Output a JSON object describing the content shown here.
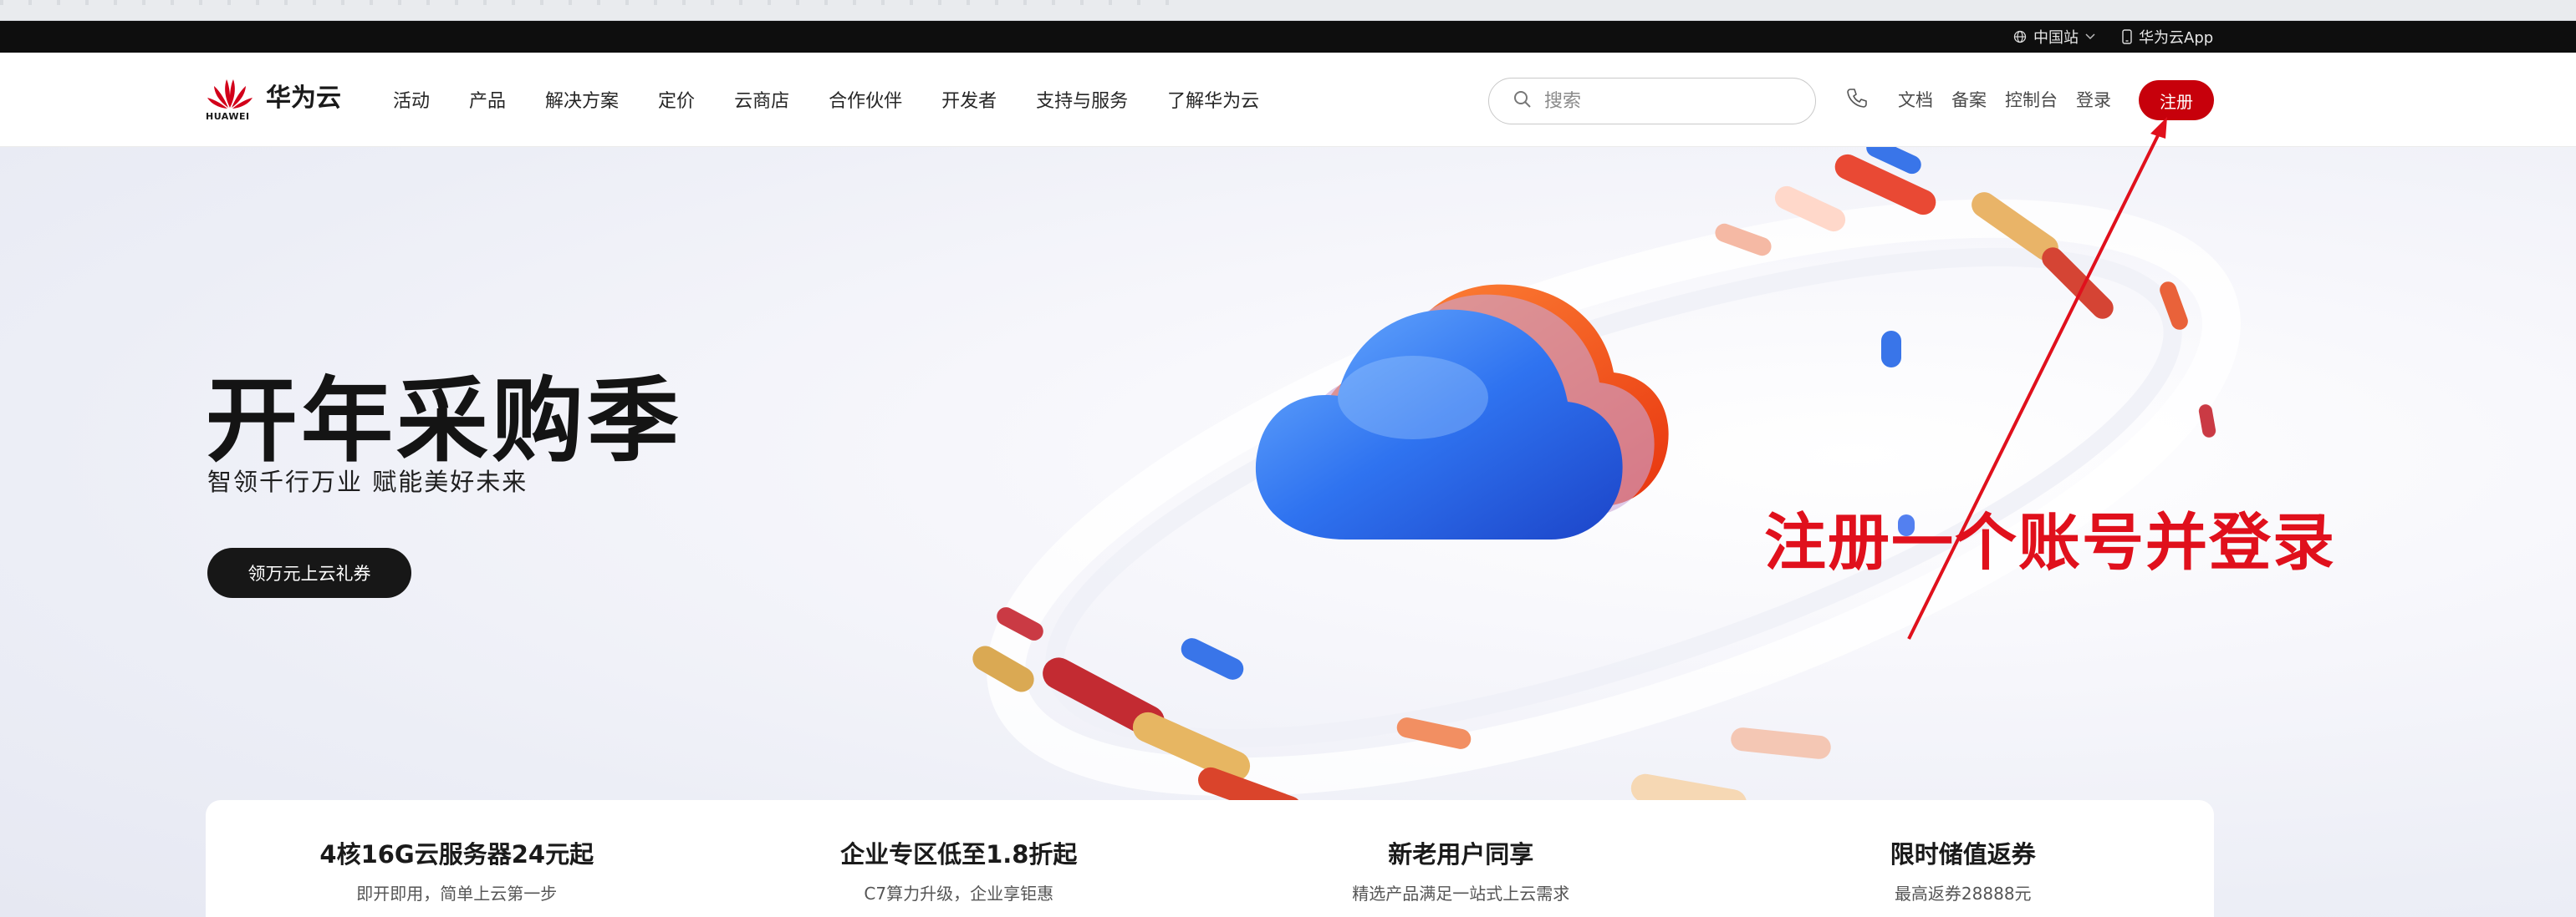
{
  "topbar": {
    "region": "中国站",
    "app": "华为云App"
  },
  "nav": {
    "logo_small": "HUAWEI",
    "logo_name": "华为云",
    "menu": [
      "活动",
      "产品",
      "解决方案",
      "定价",
      "云商店",
      "合作伙伴",
      "开发者",
      "支持与服务",
      "了解华为云"
    ],
    "search_placeholder": "搜索",
    "right_links": [
      "文档",
      "备案",
      "控制台",
      "登录"
    ],
    "register": "注册"
  },
  "hero": {
    "title": "开年采购季",
    "subtitle": "智领千行万业 赋能美好未来",
    "cta": "领万元上云礼券"
  },
  "annotation": {
    "text": "注册一个账号并登录",
    "color": "#e0101c"
  },
  "promos": [
    {
      "title": "4核16G云服务器24元起",
      "desc": "即开即用，简单上云第一步"
    },
    {
      "title": "企业专区低至1.8折起",
      "desc": "C7算力升级，企业享钜惠"
    },
    {
      "title": "新老用户同享",
      "desc": "精选产品满足一站式上云需求"
    },
    {
      "title": "限时储值返券",
      "desc": "最高返券28888元"
    }
  ],
  "colors": {
    "brand_red": "#c7000b",
    "topbar": "#0e0e0e"
  }
}
